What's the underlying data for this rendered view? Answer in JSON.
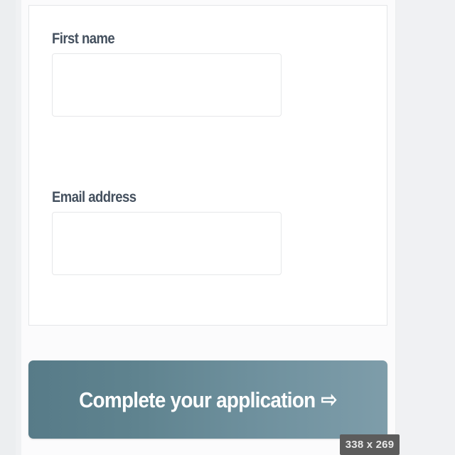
{
  "page": {
    "background_color": "#f0f1f3",
    "panel_color": "#fbfbfc",
    "card_color": "#ffffff"
  },
  "form": {
    "fields": [
      {
        "label": "First name",
        "value": "",
        "placeholder": ""
      },
      {
        "label": "Email address",
        "value": "",
        "placeholder": ""
      }
    ]
  },
  "submit": {
    "label": "Complete your application",
    "arrow_icon": "⇨",
    "gradient_start": "#577b88",
    "gradient_end": "#7e9daa",
    "text_color": "#ffffff"
  },
  "overlay": {
    "dimension_readout": "338 x 269",
    "background_color": "#5c5c5c",
    "text_color": "#e9e9e9"
  }
}
